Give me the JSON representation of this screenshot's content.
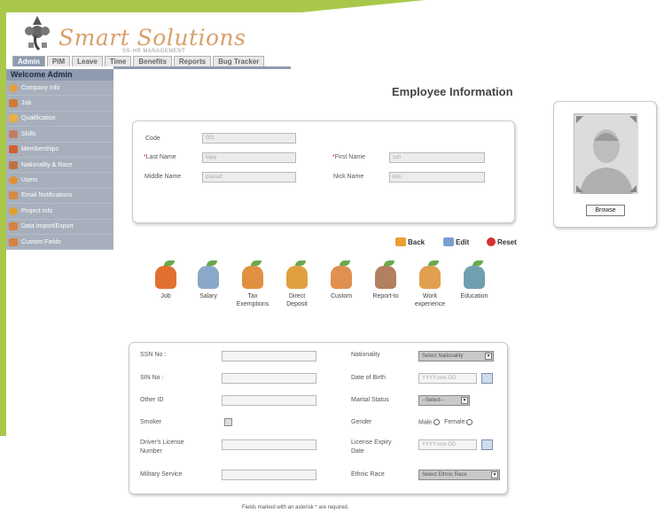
{
  "brand": {
    "name": "Smart Solutions",
    "sub": "SS-HR MANAGEMENT"
  },
  "tabs": [
    "Admin",
    "PIM",
    "Leave",
    "Time",
    "Benefits",
    "Reports",
    "Bug Tracker"
  ],
  "welcome": "Welcome Admin",
  "sidebar": [
    "Company Info",
    "Job",
    "Qualification",
    "Skills",
    "Memberships",
    "Nationality & Race",
    "Users",
    "Email Notifications",
    "Project Info",
    "Data Import/Export",
    "Custom Fields"
  ],
  "page_title": "Employee Information",
  "info": {
    "code_label": "Code",
    "code_value": "001",
    "last_name_label": "Last Name",
    "last_name_value": "bijay",
    "first_name_label": "First Name",
    "first_name_value": "ssh",
    "middle_name_label": "Middle Name",
    "middle_name_value": "prasad",
    "nick_name_label": "Nick Name",
    "nick_name_value": "biru",
    "required_mark": "*"
  },
  "photo": {
    "browse_label": "Browse"
  },
  "actions": {
    "back": "Back",
    "edit": "Edit",
    "reset": "Reset"
  },
  "modules": [
    {
      "line1": "Job",
      "line2": ""
    },
    {
      "line1": "Salary",
      "line2": ""
    },
    {
      "line1": "Tax",
      "line2": "Exemptions"
    },
    {
      "line1": "Direct",
      "line2": "Deposit"
    },
    {
      "line1": "Custom",
      "line2": ""
    },
    {
      "line1": "Report-to",
      "line2": ""
    },
    {
      "line1": "Work",
      "line2": "experience"
    },
    {
      "line1": "Education",
      "line2": ""
    }
  ],
  "details": {
    "ssn_label": "SSN No :",
    "sin_label": "SIN No :",
    "other_id_label": "Other ID",
    "smoker_label": "Smoker",
    "dl_label_1": "Driver's License",
    "dl_label_2": "Number",
    "military_label": "Military Service",
    "nationality_label": "Nationality",
    "nationality_value": "Select Nationality",
    "dob_label": "Date of Birth",
    "dob_placeholder": "YYYY-mm-DD",
    "marital_label": "Marital Status",
    "marital_value": "--Select--",
    "gender_label": "Gender",
    "gender_male": "Male",
    "gender_female": "Female",
    "lexp_label_1": "License Expiry",
    "lexp_label_2": "Date",
    "lexp_placeholder": "YYYY-mm-DD",
    "ethnic_label": "Ethnic Race",
    "ethnic_value": "Select Ethnic Race"
  },
  "footer": {
    "pre": "Fields marked with an asterisk ",
    "star": "*",
    "post": " are required."
  },
  "colors": {
    "accent_green": "#a9c84a",
    "nav_blue": "#8e9bb0",
    "sidebar_bg": "#a7afbc"
  }
}
